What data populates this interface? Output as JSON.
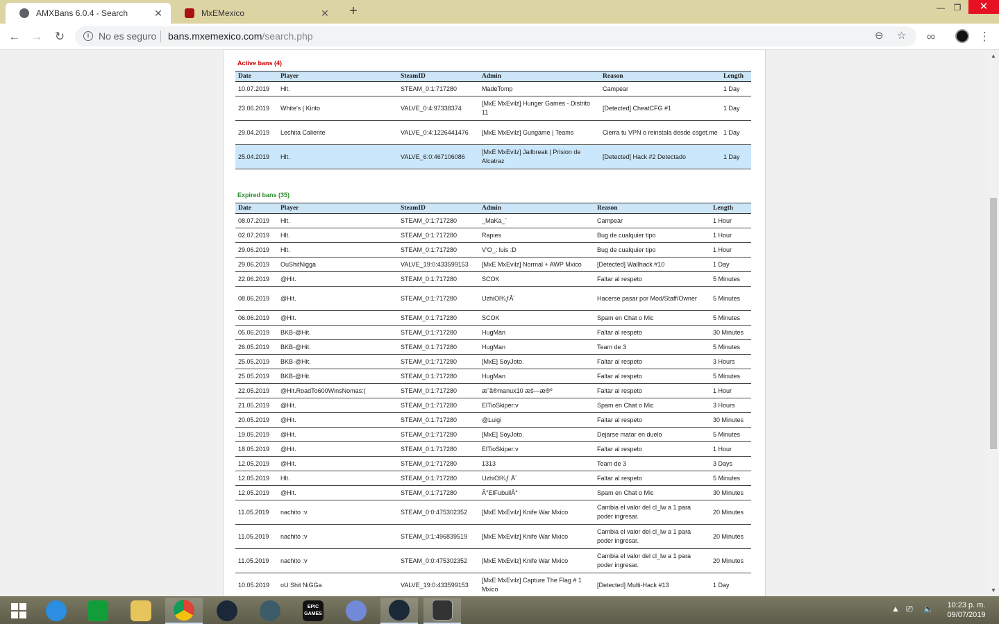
{
  "browser": {
    "tabs": [
      {
        "title": "AMXBans 6.0.4 - Search",
        "active": true,
        "favicon": "globe-icon"
      },
      {
        "title": "MxEMexico",
        "active": false,
        "favicon": "shield-icon"
      }
    ],
    "address": {
      "security": "No es seguro",
      "host": "bans.mxemexico.com",
      "path": "/search.php"
    }
  },
  "active_bans": {
    "title": "Active bans (4)",
    "headers": [
      "Date",
      "Player",
      "SteamID",
      "Admin",
      "Reason",
      "Length"
    ],
    "rows": [
      [
        "10.07.2019",
        "Hlt.",
        "STEAM_0:1:717280",
        "MadeTomp",
        "Campear",
        "1 Day"
      ],
      [
        "23.06.2019",
        "White's | Kirito",
        "VALVE_0:4:97338374",
        "[MxE MxEvilz] Hunger Games - Distrito 11",
        "[Detected] CheatCFG #1",
        "1 Day"
      ],
      [
        "29.04.2019",
        "Lechita Caliente",
        "VALVE_0:4:1226441476",
        "[MxE MxEvilz] Gungame | Teams",
        "Cierra tu VPN o reinstala desde csget.me",
        "1 Day"
      ],
      [
        "25.04.2019",
        "Hlt.",
        "VALVE_6:0:467106086",
        "[MxE MxEvilz] Jailbreak | Prision de Alcatraz",
        "[Detected] Hack #2 Detectado",
        "1 Day"
      ]
    ]
  },
  "expired_bans": {
    "title": "Expired bans (35)",
    "headers": [
      "Date",
      "Player",
      "SteamID",
      "Admin",
      "Reason",
      "Length"
    ],
    "rows": [
      [
        "08.07.2019",
        "Hlt.",
        "STEAM_0:1:717280",
        "_MaKa_`",
        "Campear",
        "1 Hour"
      ],
      [
        "02.07.2019",
        "Hlt.",
        "STEAM_0:1:717280",
        "Rapies",
        "Bug de cualquier tipo",
        "1 Hour"
      ],
      [
        "29.06.2019",
        "Hlt.",
        "STEAM_0:1:717280",
        "V'O_: luis :D",
        "Bug de cualquier tipo",
        "1 Hour"
      ],
      [
        "29.06.2019",
        "OuShitNigga",
        "VALVE_19:0:433599153",
        "[MxE MxEvilz] Normal + AWP Mxico",
        "[Detected] Wallhack #10",
        "1 Day"
      ],
      [
        "22.06.2019",
        "@Hit.",
        "STEAM_0:1:717280",
        "SCOK",
        "Faltar al respeto",
        "5 Minutes"
      ],
      [
        "08.06.2019",
        "@Hit.",
        "STEAM_0:1:717280",
        "UzhiOl¾ƒÂ´",
        "Hacerse pasar por Mod/Staff/Owner",
        "5 Minutes"
      ],
      [
        "06.06.2019",
        "@Hit.",
        "STEAM_0:1:717280",
        "SCOK",
        "Spam en Chat o Mic",
        "5 Minutes"
      ],
      [
        "05.06.2019",
        "BKB-@Hit.",
        "STEAM_0:1:717280",
        "HugMan",
        "Faltar al respeto",
        "30 Minutes"
      ],
      [
        "26.05.2019",
        "BKB-@Hit.",
        "STEAM_0:1:717280",
        "HugMan",
        "Team de 3",
        "5 Minutes"
      ],
      [
        "25.05.2019",
        "BKB-@Hit.",
        "STEAM_0:1:717280",
        "[MxE] SoyJoto.",
        "Faltar al respeto",
        "3 Hours"
      ],
      [
        "25.05.2019",
        "BKB-@Hit.",
        "STEAM_0:1:717280",
        "HugMan",
        "Faltar al respeto",
        "5 Minutes"
      ],
      [
        "22.05.2019",
        "@Hit.RoadTo600WinsNomas:(",
        "STEAM_0:1:717280",
        "æ˜ã®manux10 æš—æ®º",
        "Faltar al respeto",
        "1 Hour"
      ],
      [
        "21.05.2019",
        "@Hit.",
        "STEAM_0:1:717280",
        "ElTioSkiper:v",
        "Spam en Chat o Mic",
        "3 Hours"
      ],
      [
        "20.05.2019",
        "@Hit.",
        "STEAM_0:1:717280",
        "@Luigi",
        "Faltar al respeto",
        "30 Minutes"
      ],
      [
        "19.05.2019",
        "@Hit.",
        "STEAM_0:1:717280",
        "[MxE] SoyJoto.",
        "Dejarse matar en duelo",
        "5 Minutes"
      ],
      [
        "18.05.2019",
        "@Hit.",
        "STEAM_0:1:717280",
        "ElTioSkiper:v",
        "Faltar al respeto",
        "1 Hour"
      ],
      [
        "12.05.2019",
        "@Hit.",
        "STEAM_0:1:717280",
        "1313",
        "Team de 3",
        "3 Days"
      ],
      [
        "12.05.2019",
        "Hlt.",
        "STEAM_0:1:717280",
        "UzhiOl¾ƒ.Â´",
        "Faltar al respeto",
        "5 Minutes"
      ],
      [
        "12.05.2019",
        "@Hit.",
        "STEAM_0:1:717280",
        "Â°ElFubullÂ°",
        "Spam en Chat o Mic",
        "30 Minutes"
      ],
      [
        "11.05.2019",
        "nachito :v",
        "STEAM_0:0:475302352",
        "[MxE MxEvilz] Knife War Mxico",
        "Cambia el valor del cl_lw a 1 para poder ingresar.",
        "20 Minutes"
      ],
      [
        "11.05.2019",
        "nachito :v",
        "STEAM_0:1:496839519",
        "[MxE MxEvilz] Knife War Mxico",
        "Cambia el valor del cl_lw a 1 para poder ingresar.",
        "20 Minutes"
      ],
      [
        "11.05.2019",
        "nachito :v",
        "STEAM_0:0:475302352",
        "[MxE MxEvilz] Knife War Mxico",
        "Cambia el valor del cl_lw a 1 para poder ingresar.",
        "20 Minutes"
      ],
      [
        "10.05.2019",
        "oU Shit NiGGa",
        "VALVE_19:0:433599153",
        "[MxE MxEvilz] Capture The Flag # 1 Mxico",
        "[Detected] Multi-Hack #13",
        "1 Day"
      ]
    ]
  },
  "taskbar": {
    "time": "10:23 p. m.",
    "date": "09/07/2019",
    "apps": [
      "windows-start-icon",
      "ie-icon",
      "store-icon",
      "file-explorer-icon",
      "chrome-icon",
      "steam-icon",
      "app-icon",
      "epic-games-icon",
      "discord-icon",
      "steam-icon",
      "app-icon"
    ],
    "epic_label": "EPIC GAMES"
  }
}
